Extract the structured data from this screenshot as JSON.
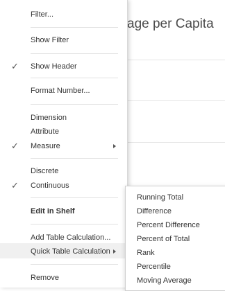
{
  "background": {
    "title_fragment": "age per Capita"
  },
  "menu": {
    "filter": "Filter...",
    "show_filter": "Show Filter",
    "show_header": "Show Header",
    "format_number": "Format Number...",
    "dimension": "Dimension",
    "attribute": "Attribute",
    "measure": "Measure",
    "discrete": "Discrete",
    "continuous": "Continuous",
    "edit_in_shelf": "Edit in Shelf",
    "add_table_calculation": "Add Table Calculation...",
    "quick_table_calculation": "Quick Table Calculation",
    "remove": "Remove",
    "check_mark": "✓"
  },
  "submenu": {
    "items": [
      "Running Total",
      "Difference",
      "Percent Difference",
      "Percent of Total",
      "Rank",
      "Percentile",
      "Moving Average"
    ]
  }
}
